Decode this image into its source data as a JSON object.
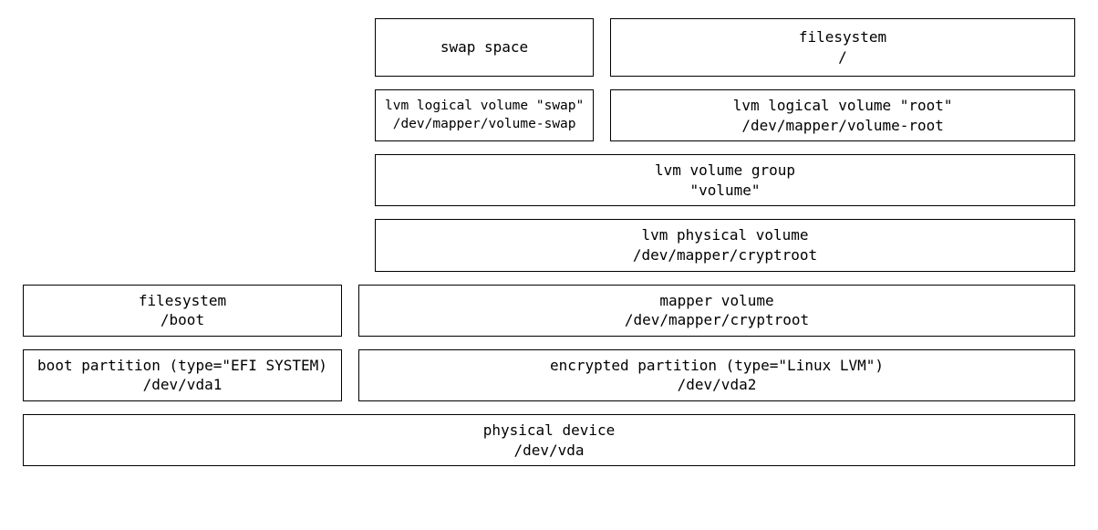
{
  "layers": {
    "top": {
      "swap": {
        "line1": "swap space"
      },
      "fsroot": {
        "line1": "filesystem",
        "line2": "/"
      }
    },
    "lv": {
      "swap": {
        "line1": "lvm logical volume \"swap\"",
        "line2": "/dev/mapper/volume-swap"
      },
      "root": {
        "line1": "lvm logical volume \"root\"",
        "line2": "/dev/mapper/volume-root"
      }
    },
    "vg": {
      "line1": "lvm volume group",
      "line2": "\"volume\""
    },
    "pv": {
      "line1": "lvm physical volume",
      "line2": "/dev/mapper/cryptroot"
    },
    "bootfs": {
      "line1": "filesystem",
      "line2": "/boot"
    },
    "mapper": {
      "line1": "mapper volume",
      "line2": "/dev/mapper/cryptroot"
    },
    "bootpart": {
      "line1": "boot partition (type=\"EFI SYSTEM)",
      "line2": "/dev/vda1"
    },
    "encpart": {
      "line1": "encrypted partition (type=\"Linux LVM\")",
      "line2": "/dev/vda2"
    },
    "physdev": {
      "line1": "physical device",
      "line2": "/dev/vda"
    }
  }
}
